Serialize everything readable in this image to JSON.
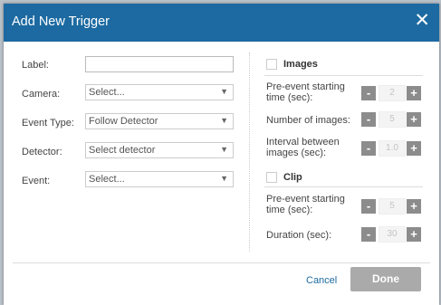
{
  "dialog": {
    "title": "Add New Trigger",
    "close_glyph": "✕"
  },
  "form": {
    "label": {
      "label": "Label:",
      "value": ""
    },
    "camera": {
      "label": "Camera:",
      "value": "Select..."
    },
    "event_type": {
      "label": "Event Type:",
      "value": "Follow Detector"
    },
    "detector": {
      "label": "Detector:",
      "value": "Select detector"
    },
    "event": {
      "label": "Event:",
      "value": "Select..."
    },
    "arrow_glyph": "▼"
  },
  "images": {
    "title": "Images",
    "pre_event_label": "Pre-event starting time (sec):",
    "pre_event_value": "2",
    "number_label": "Number of images:",
    "number_value": "5",
    "interval_label": "Interval between images (sec):",
    "interval_value": "1.0"
  },
  "clip": {
    "title": "Clip",
    "pre_event_label": "Pre-event starting time (sec):",
    "pre_event_value": "5",
    "duration_label": "Duration (sec):",
    "duration_value": "30"
  },
  "stepper": {
    "minus": "-",
    "plus": "+"
  },
  "footer": {
    "cancel": "Cancel",
    "done": "Done"
  },
  "colors": {
    "title_bar": "#1c6aa1",
    "link": "#1c6aa1",
    "done_button": "#aaaaaa"
  }
}
